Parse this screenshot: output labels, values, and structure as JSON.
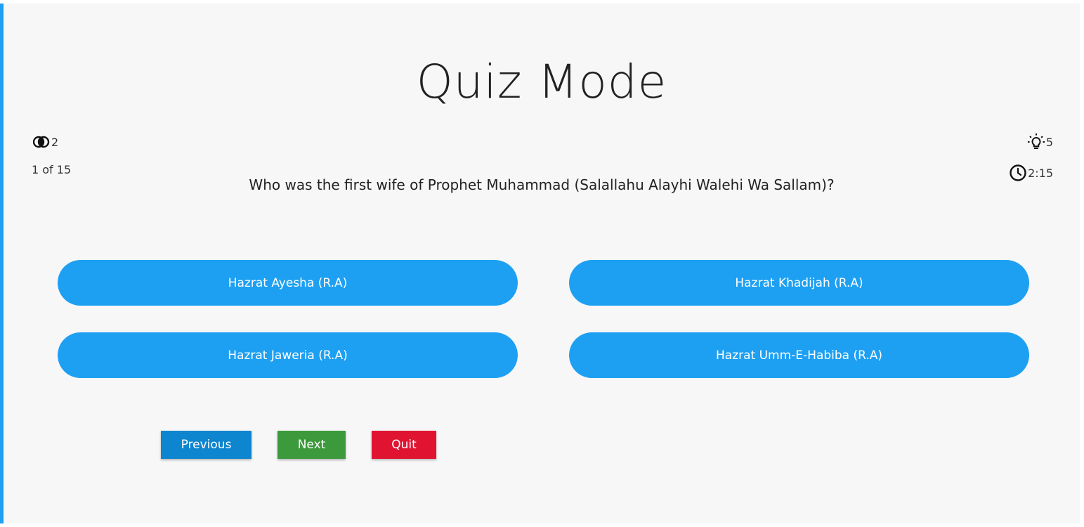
{
  "page": {
    "title": "Quiz Mode"
  },
  "stats": {
    "lifelines": "2",
    "question_counter": "1 of 15",
    "hints": "5",
    "timer": "2:15"
  },
  "question": {
    "text": "Who was the first wife of Prophet Muhammad (Salallahu Alayhi Walehi Wa Sallam)?"
  },
  "options": [
    "Hazrat Ayesha (R.A)",
    "Hazrat Khadijah (R.A)",
    "Hazrat Jaweria (R.A)",
    "Hazrat Umm-E-Habiba (R.A)"
  ],
  "buttons": {
    "previous": "Previous",
    "next": "Next",
    "quit": "Quit"
  },
  "icons": {
    "lifelines": "fifty-fifty-icon",
    "hints": "lightbulb-icon",
    "timer": "clock-icon"
  },
  "colors": {
    "accent": "#1ea0f2",
    "previous": "#0e85cf",
    "next": "#3d9a3c",
    "quit": "#e01431",
    "background": "#f7f7f7"
  }
}
